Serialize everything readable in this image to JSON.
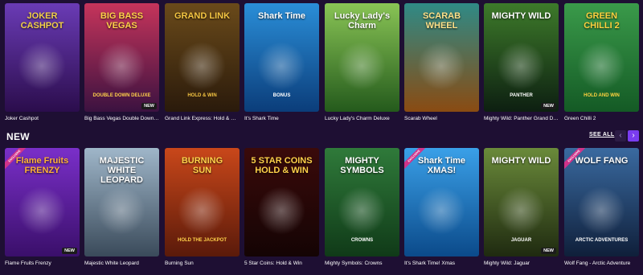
{
  "row1": {
    "games": [
      {
        "name": "Joker Cashpot",
        "art": "JOKER\nCASHPOT",
        "colors": [
          "#6a3bb5",
          "#2b0d4c"
        ],
        "title_color": "#f2d04a"
      },
      {
        "name": "Big Bass Vegas Double Down Deluxe",
        "art": "BIG BASS\nVEGAS",
        "colors": [
          "#c6345b",
          "#3b1240"
        ],
        "title_color": "#ffd24a",
        "subtitle": "DOUBLE DOWN DELUXE",
        "badge": "NEW"
      },
      {
        "name": "Grand Link Express: Hold & Win",
        "art": "GRAND LINK",
        "colors": [
          "#6a4a1a",
          "#2a1a0b"
        ],
        "title_color": "#f4c542",
        "subtitle": "HOLD & WIN"
      },
      {
        "name": "It's Shark Time",
        "art": "Shark Time",
        "colors": [
          "#2a8ed8",
          "#0b3d7a"
        ],
        "title_color": "#ffffff",
        "subtitle": "BONUS"
      },
      {
        "name": "Lucky Lady's Charm Deluxe",
        "art": "Lucky Lady's\nCharm",
        "colors": [
          "#89c455",
          "#245a1c"
        ],
        "title_color": "#ffffff"
      },
      {
        "name": "Scarab Wheel",
        "art": "SCARAB\nWHEEL",
        "colors": [
          "#2f8a86",
          "#8a4b12"
        ],
        "title_color": "#ffe28a"
      },
      {
        "name": "Mighty Wild: Panther Grand Diamond Edition",
        "art": "MIGHTY WILD",
        "colors": [
          "#3d7a2a",
          "#0d1f11"
        ],
        "title_color": "#ffffff",
        "subtitle": "PANTHER",
        "badge": "NEW"
      },
      {
        "name": "Green Chilli 2",
        "art": "GREEN\nCHILLI 2",
        "colors": [
          "#3a9a4a",
          "#145a25"
        ],
        "title_color": "#ffd23f",
        "subtitle": "HOLD AND WIN"
      }
    ]
  },
  "row2": {
    "title": "NEW",
    "see_all": "SEE ALL",
    "prev_glyph": "‹",
    "next_glyph": "›",
    "games": [
      {
        "name": "Flame Fruits Frenzy",
        "art": "Flame Fruits\nFRENZY",
        "colors": [
          "#7a2fc9",
          "#3a0f6a"
        ],
        "title_color": "#ffb13a",
        "badge": "NEW",
        "excl": "EXCLUSIVE"
      },
      {
        "name": "Majestic White Leopard",
        "art": "MAJESTIC WHITE LEOPARD",
        "colors": [
          "#9fb6c9",
          "#3a4a5a"
        ],
        "title_color": "#ffffff"
      },
      {
        "name": "Burning Sun",
        "art": "BURNING\nSUN",
        "colors": [
          "#c9471a",
          "#5a1a0a"
        ],
        "title_color": "#ffd24a",
        "subtitle": "HOLD THE JACKPOT"
      },
      {
        "name": "5 Star Coins: Hold & Win",
        "art": "5 STAR COINS\nHOLD & WIN",
        "colors": [
          "#3a0a0a",
          "#140404"
        ],
        "title_color": "#ffd24a"
      },
      {
        "name": "Mighty Symbols: Crowns",
        "art": "MIGHTY SYMBOLS",
        "colors": [
          "#2f7a3a",
          "#103a18"
        ],
        "title_color": "#ffffff",
        "subtitle": "CROWNS"
      },
      {
        "name": "It's Shark Time! Xmas",
        "art": "Shark Time\nXMAS!",
        "colors": [
          "#3aa0e8",
          "#0b4a8a"
        ],
        "title_color": "#ffffff",
        "excl": "EXCLUSIVE"
      },
      {
        "name": "Mighty Wild: Jaguar",
        "art": "MIGHTY WILD",
        "colors": [
          "#6a8a3a",
          "#1f2a10"
        ],
        "title_color": "#ffffff",
        "subtitle": "JAGUAR",
        "badge": "NEW"
      },
      {
        "name": "Wolf Fang - Arctic Adventure",
        "art": "WOLF FANG",
        "colors": [
          "#3a6aa0",
          "#0f1f3a"
        ],
        "title_color": "#ffffff",
        "subtitle": "ARCTIC ADVENTURES",
        "excl": "EXCLUSIVE"
      }
    ]
  }
}
